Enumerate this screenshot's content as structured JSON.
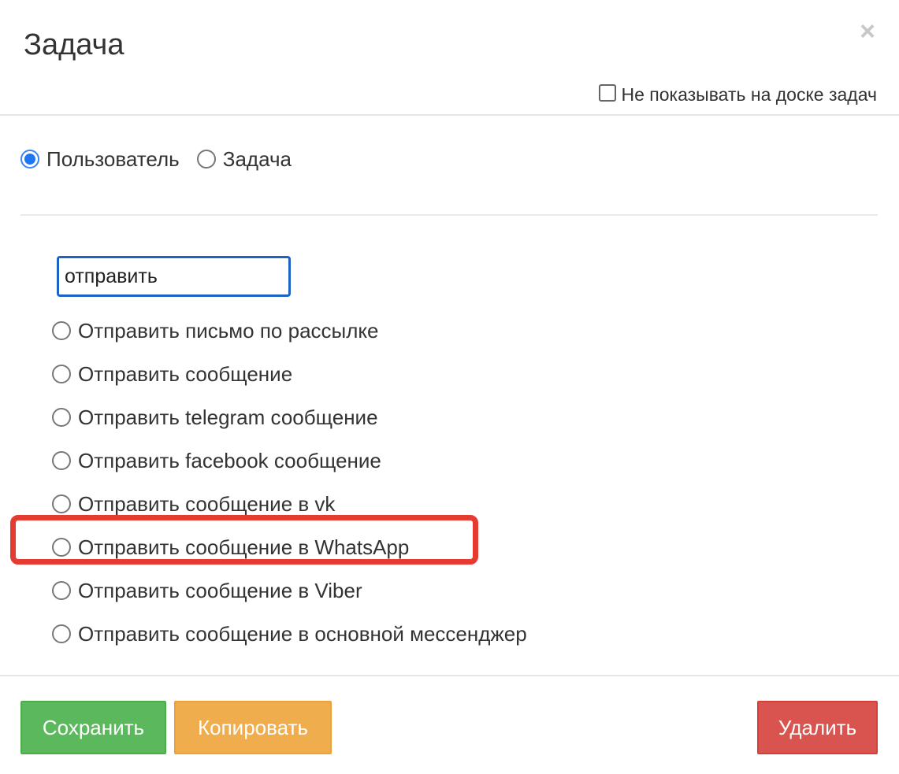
{
  "header": {
    "title": "Задача",
    "close_symbol": "×",
    "hide_on_board_label": "Не показывать на доске задач",
    "hide_on_board_checked": false
  },
  "type_selector": {
    "options": [
      {
        "label": "Пользователь",
        "checked": true
      },
      {
        "label": "Задача",
        "checked": false
      }
    ]
  },
  "search": {
    "value": "отправить",
    "placeholder": ""
  },
  "actions": [
    {
      "label": "Отправить письмо по рассылке",
      "checked": false,
      "highlighted": false
    },
    {
      "label": "Отправить сообщение",
      "checked": false,
      "highlighted": false
    },
    {
      "label": "Отправить telegram сообщение",
      "checked": false,
      "highlighted": false
    },
    {
      "label": "Отправить facebook сообщение",
      "checked": false,
      "highlighted": false
    },
    {
      "label": "Отправить сообщение в vk",
      "checked": false,
      "highlighted": false
    },
    {
      "label": "Отправить сообщение в WhatsApp",
      "checked": false,
      "highlighted": true
    },
    {
      "label": "Отправить сообщение в Viber",
      "checked": false,
      "highlighted": false
    },
    {
      "label": "Отправить сообщение в основной мессенджер",
      "checked": false,
      "highlighted": false
    }
  ],
  "footer": {
    "save_label": "Сохранить",
    "copy_label": "Копировать",
    "delete_label": "Удалить"
  },
  "colors": {
    "save": "#5cb85c",
    "copy": "#f0ad4e",
    "delete": "#d9534f",
    "highlight": "#e53b31",
    "input_focus": "#1d63c6",
    "radio_checked": "#1f77f2"
  }
}
